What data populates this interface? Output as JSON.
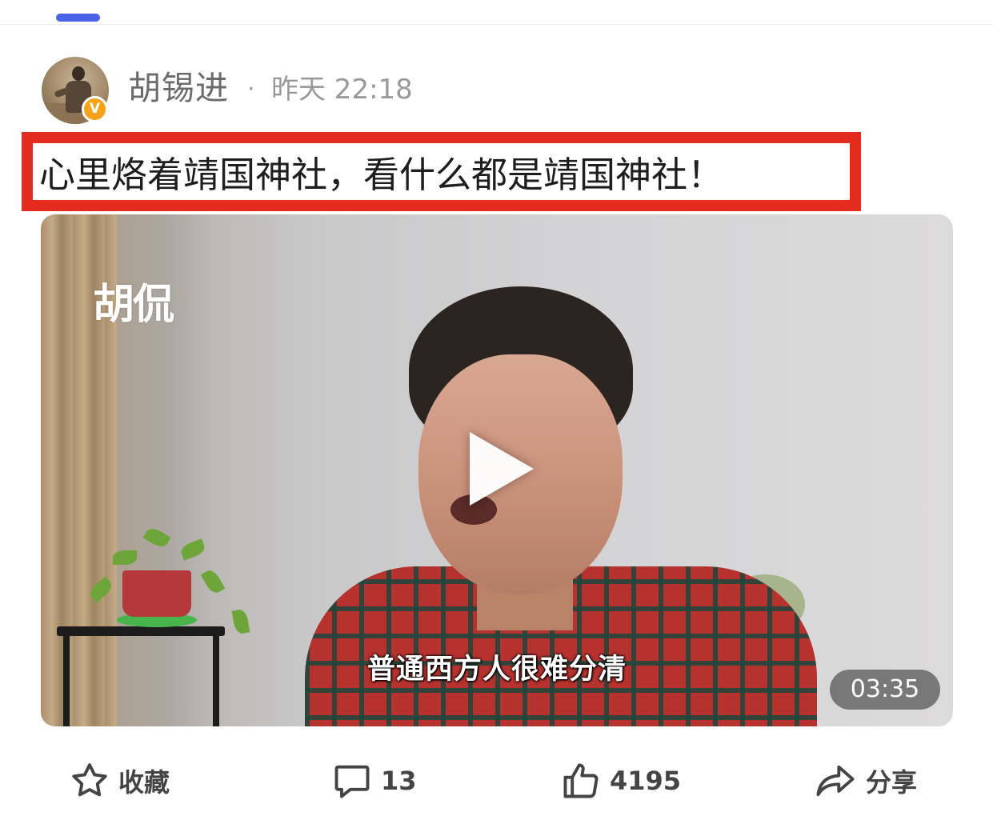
{
  "post": {
    "author": "胡锡进",
    "separator": "·",
    "time": "昨天 22:18",
    "text": "心里烙着靖国神社，看什么都是靖国神社！",
    "verified_mark": "V"
  },
  "video": {
    "watermark": "胡侃",
    "subtitle": "普通西方人很难分清",
    "duration": "03:35"
  },
  "actions": {
    "favorite_label": "收藏",
    "comment_count": "13",
    "like_count": "4195",
    "share_label": "分享"
  },
  "colors": {
    "highlight_border": "#e32b1e",
    "tab_indicator": "#4a62e8",
    "verified_badge": "#f7a21b"
  }
}
